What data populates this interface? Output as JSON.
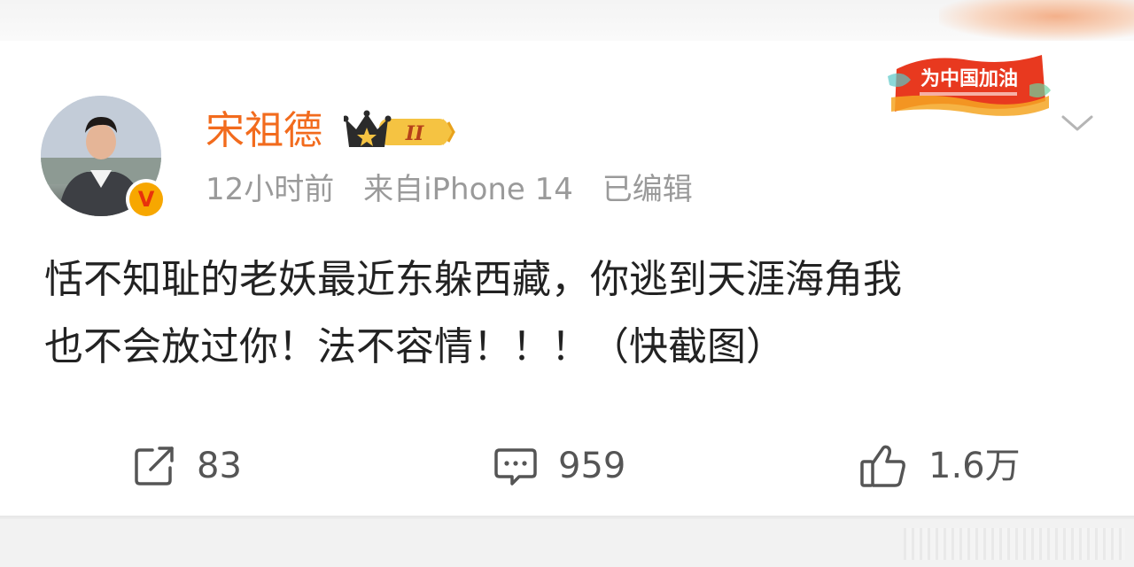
{
  "post": {
    "author": {
      "name": "宋祖德",
      "vip_level": "II",
      "verified_mark": "V"
    },
    "meta": {
      "time": "12小时前",
      "source": "来自iPhone 14",
      "edited": "已编辑"
    },
    "badge": {
      "text": "为中国加油"
    },
    "content": {
      "line1": "恬不知耻的老妖最近东躲西藏，你逃到天涯海角我",
      "line2": "也不会放过你！法不容情！！！（快截图）"
    },
    "actions": {
      "repost_count": "83",
      "comment_count": "959",
      "like_count": "1.6万"
    }
  },
  "icons": [
    "share-icon",
    "comment-icon",
    "thumbs-up-icon",
    "chevron-down-icon",
    "crown-icon"
  ],
  "colors": {
    "username": "#f26b1d",
    "meta": "#9a9a9a",
    "text": "#222222",
    "action": "#555555",
    "verified": "#f7a700"
  }
}
